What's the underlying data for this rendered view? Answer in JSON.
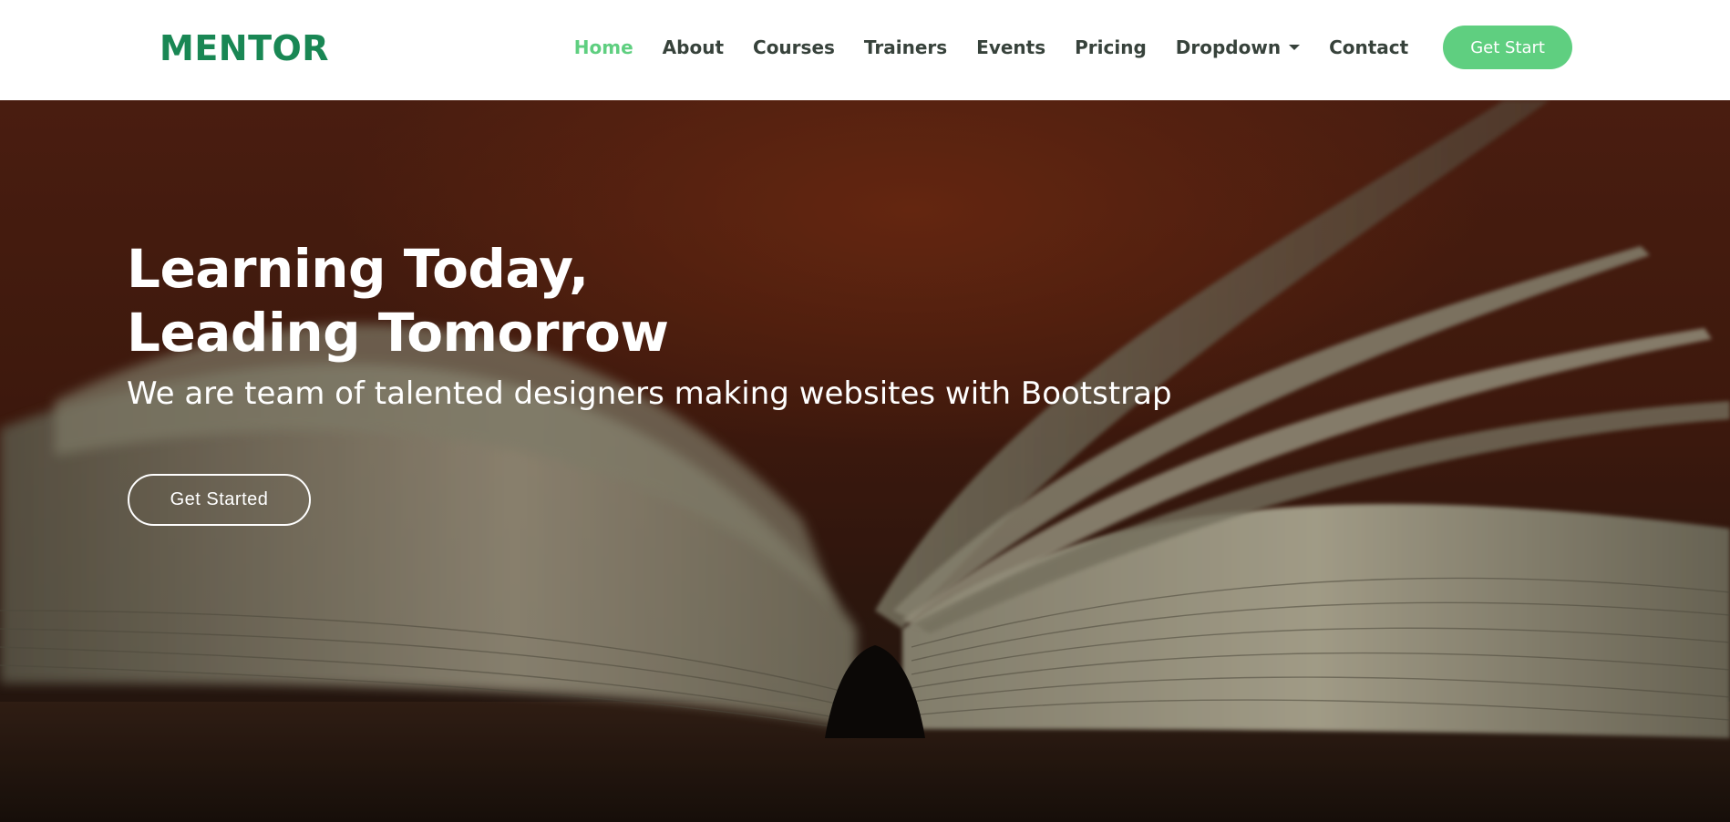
{
  "header": {
    "logo": "MENTOR",
    "nav": [
      {
        "label": "Home",
        "active": true
      },
      {
        "label": "About"
      },
      {
        "label": "Courses"
      },
      {
        "label": "Trainers"
      },
      {
        "label": "Events"
      },
      {
        "label": "Pricing"
      },
      {
        "label": "Dropdown",
        "has_caret": true
      },
      {
        "label": "Contact"
      }
    ],
    "cta_label": "Get Start"
  },
  "hero": {
    "title_line1": "Learning Today,",
    "title_line2": "Leading Tomorrow",
    "subtitle": "We are team of talented designers making websites with Bootstrap",
    "button_label": "Get Started",
    "background_image": "open-book-photo"
  },
  "colors": {
    "brand": "#198754",
    "accent": "#5fcf80",
    "nav_text": "#37423b",
    "header_bg": "#ffffff",
    "hero_text": "#ffffff"
  }
}
